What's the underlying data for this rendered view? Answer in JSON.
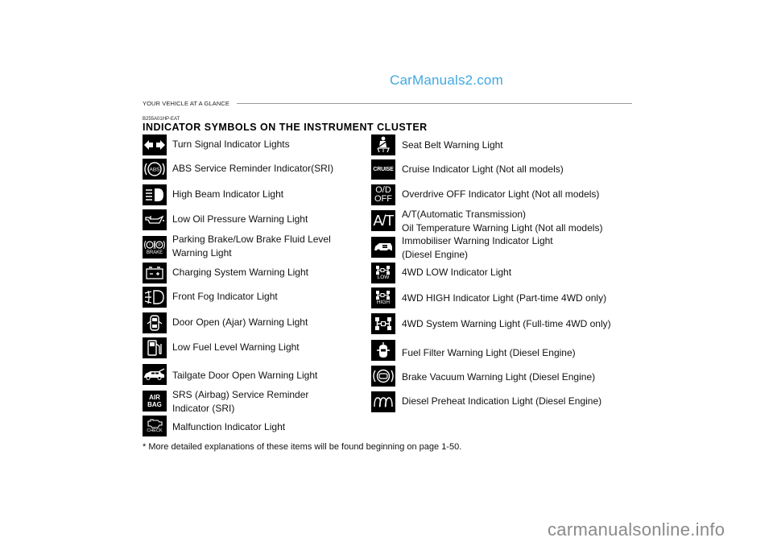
{
  "watermarks": {
    "top": "CarManuals2.com",
    "bottom": "carmanualsonline.info"
  },
  "header": {
    "section": "YOUR VEHICLE AT A GLANCE",
    "code": "B255A01HP-EAT",
    "title": "INDICATOR SYMBOLS ON THE INSTRUMENT CLUSTER"
  },
  "left_column": [
    {
      "icon": "turn-signal-icon",
      "label": "Turn Signal Indicator Lights"
    },
    {
      "icon": "abs-icon",
      "icon_text": "ABS",
      "label": "ABS Service Reminder Indicator(SRI)"
    },
    {
      "icon": "high-beam-icon",
      "label": "High Beam Indicator Light"
    },
    {
      "icon": "oil-pressure-icon",
      "label": "Low Oil Pressure Warning Light"
    },
    {
      "icon": "parking-brake-icon",
      "icon_text": "BRAKE",
      "label_lines": [
        "Parking Brake/Low Brake Fluid Level",
        "Warning Light"
      ]
    },
    {
      "icon": "battery-icon",
      "icon_text": "- +",
      "label": "Charging System Warning Light"
    },
    {
      "icon": "front-fog-icon",
      "label": "Front Fog Indicator Light"
    },
    {
      "icon": "door-open-icon",
      "label": "Door Open (Ajar) Warning Light"
    },
    {
      "icon": "fuel-pump-icon",
      "label": "Low Fuel Level Warning Light"
    },
    {
      "icon": "tailgate-icon",
      "label": "Tailgate Door Open Warning Light"
    },
    {
      "icon": "airbag-icon",
      "icon_text_lines": [
        "AIR",
        "BAG"
      ],
      "label_lines": [
        "SRS (Airbag) Service Reminder",
        "Indicator (SRI)"
      ]
    },
    {
      "icon": "check-engine-icon",
      "icon_text": "CHECK",
      "label": "Malfunction Indicator Light"
    }
  ],
  "right_column": [
    {
      "icon": "seat-belt-icon",
      "label": "Seat Belt Warning Light"
    },
    {
      "icon": "cruise-icon",
      "icon_text": "CRUISE",
      "label": "Cruise Indicator Light (Not all models)"
    },
    {
      "icon": "overdrive-off-icon",
      "icon_text_lines": [
        "O/D",
        "OFF"
      ],
      "label": "Overdrive OFF Indicator Light (Not all models)"
    },
    {
      "icon": "at-temp-icon",
      "icon_text": "A/T",
      "label_lines": [
        "A/T(Automatic Transmission)",
        "Oil Temperature Warning Light (Not all models)"
      ]
    },
    {
      "icon": "immobiliser-icon",
      "label_lines": [
        "Immobiliser Warning Indicator Light",
        "(Diesel Engine)"
      ]
    },
    {
      "icon": "4wd-low-icon",
      "icon_text": "LOW",
      "label": "4WD LOW Indicator Light"
    },
    {
      "icon": "4wd-high-icon",
      "icon_text": "HIGH",
      "label": "4WD HIGH Indicator Light (Part-time 4WD only)"
    },
    {
      "icon": "4wd-system-icon",
      "label": "4WD  System Warning Light (Full-time 4WD only)"
    },
    {
      "icon": "fuel-filter-icon",
      "label": "Fuel Filter Warning Light (Diesel Engine)"
    },
    {
      "icon": "brake-vacuum-icon",
      "label": "Brake Vacuum Warning Light (Diesel Engine)"
    },
    {
      "icon": "diesel-preheat-icon",
      "label": "Diesel Preheat Indication Light (Diesel Engine)"
    }
  ],
  "footnote": "* More detailed explanations of these items will be found beginning on page 1-50."
}
